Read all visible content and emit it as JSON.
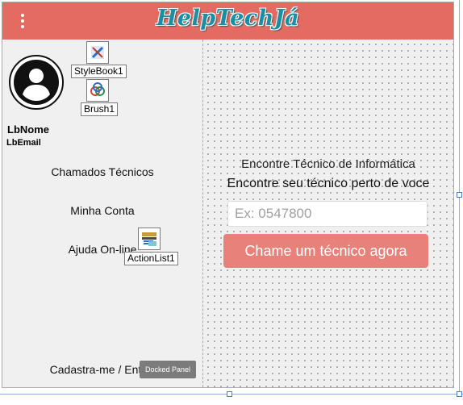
{
  "header": {
    "title": "HelpTechJá",
    "menu_icon": "more-vertical-icon",
    "color": "#e36b62"
  },
  "sidebar": {
    "avatar_icon": "account-circle-icon",
    "name_label": "LbNome",
    "email_label": "LbEmail",
    "items": [
      {
        "label": "Chamados Técnicos"
      },
      {
        "label": "Minha Conta"
      },
      {
        "label": "Ajuda On-line"
      },
      {
        "label": "Cadastra-me / Entrar"
      }
    ]
  },
  "main": {
    "heading": "Encontre Técnico de Informática",
    "subheading": "Encontre seu técnico perto de voce",
    "phone_placeholder": "Ex: 0547800",
    "call_button": "Chame um técnico agora",
    "button_color": "#e8817a"
  },
  "designer": {
    "components": [
      {
        "label": "StyleBook1",
        "icon": "stylebook-icon"
      },
      {
        "label": "Brush1",
        "icon": "brush-icon"
      },
      {
        "label": "ActionList1",
        "icon": "actionlist-icon"
      }
    ],
    "docked_badge": "Docked Panel"
  }
}
